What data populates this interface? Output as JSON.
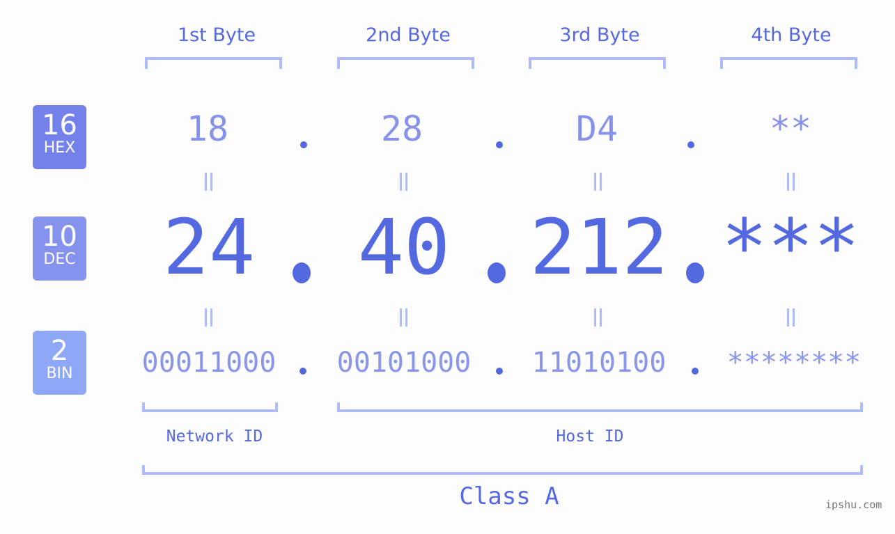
{
  "bytes": {
    "headers": [
      "1st Byte",
      "2nd Byte",
      "3rd Byte",
      "4th Byte"
    ]
  },
  "badges": {
    "hex": {
      "num": "16",
      "label": "HEX"
    },
    "dec": {
      "num": "10",
      "label": "DEC"
    },
    "bin": {
      "num": "2",
      "label": "BIN"
    }
  },
  "ip": {
    "hex": [
      "18",
      "28",
      "D4",
      "**"
    ],
    "dec": [
      "24",
      "40",
      "212",
      "***"
    ],
    "bin": [
      "00011000",
      "00101000",
      "11010100",
      "********"
    ],
    "separator": "."
  },
  "parts": {
    "network_id": "Network ID",
    "host_id": "Host ID",
    "class": "Class A"
  },
  "colors": {
    "accent": "#5468e0",
    "hex_badge": "#7481ea",
    "dec_badge": "#8592ee",
    "bin_badge": "#8fa7f7",
    "bracket": "#b1bbf5"
  },
  "watermark": "ipshu.com"
}
